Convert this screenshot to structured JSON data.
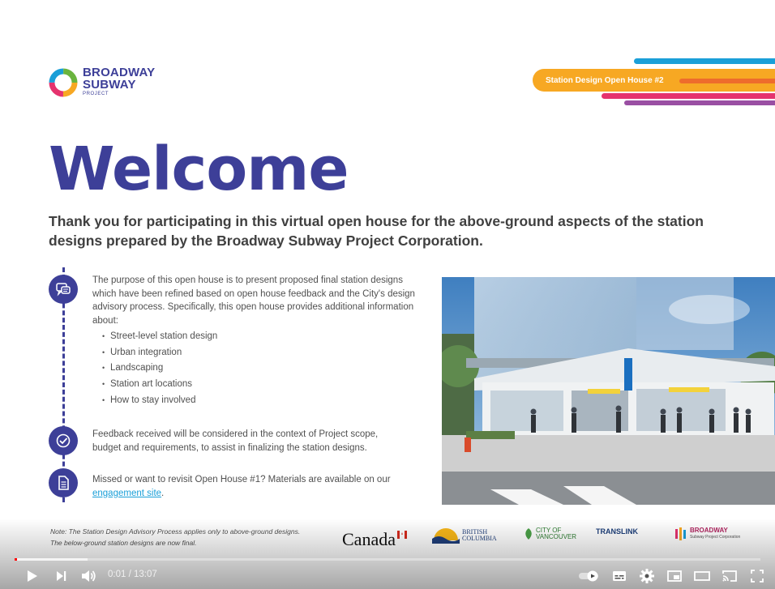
{
  "logo": {
    "line1": "BROADWAY",
    "line2": "SUBWAY",
    "line3": "PROJECT"
  },
  "badge": "Station Design Open House #2",
  "title": "Welcome",
  "subtitle": "Thank you for participating in this virtual open house for the above-ground aspects of the station designs prepared by the Broadway Subway Project Corporation.",
  "body": {
    "intro": "The purpose of this open house is to present proposed final station designs which have been refined based on open house feedback and the City's design advisory process. Specifically, this open house provides additional information about:",
    "bullets": [
      "Street-level station design",
      "Urban integration",
      "Landscaping",
      "Station art locations",
      "How to stay involved"
    ],
    "feedback": "Feedback received will be considered in the context of Project scope, budget and requirements, to assist in finalizing the station designs.",
    "missed_prefix": "Missed or want to revisit Open House #1? Materials are available on our ",
    "missed_link": "engagement site",
    "missed_suffix": "."
  },
  "note": "Note: The Station Design Advisory Process applies only to above-ground designs. The below-ground station designs are now final.",
  "partners": {
    "canada": "Canada",
    "bc_line1": "BRITISH",
    "bc_line2": "COLUMBIA",
    "van_line1": "CITY OF",
    "van_line2": "VANCOUVER",
    "translink": "TRANSLINK",
    "bsp_line1": "BROADWAY",
    "bsp_line2": "Subway Project Corporation"
  },
  "player": {
    "time": "0:01 / 13:07",
    "progress_fraction": 0.0013
  },
  "colors": {
    "brand_purple": "#3d3f98",
    "accent_orange": "#f7a823",
    "link_blue": "#1a9fd8"
  }
}
